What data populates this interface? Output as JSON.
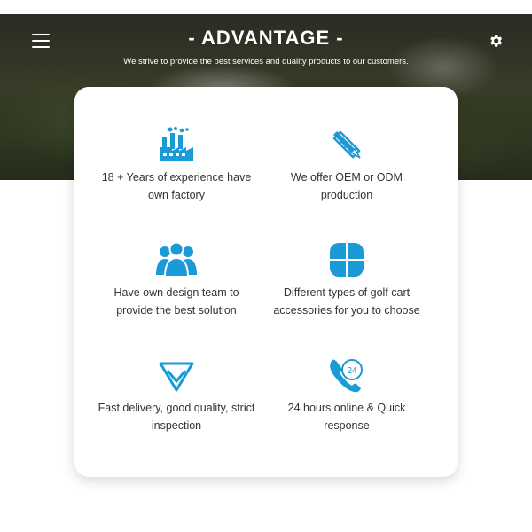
{
  "header": {
    "title": "- ADVANTAGE -",
    "subtitle": "We strive to provide the best services and quality products to our customers."
  },
  "icons": {
    "menu": "menu-icon",
    "settings": "gear-icon"
  },
  "colors": {
    "accent": "#1a9ad6",
    "text": "#333333",
    "card_bg": "#ffffff"
  },
  "features": [
    {
      "icon": "factory-icon",
      "text": "18 + Years of experience have own factory"
    },
    {
      "icon": "pencil-ruler-icon",
      "text": "We offer OEM or ODM production"
    },
    {
      "icon": "team-icon",
      "text": "Have own design team to provide the best solution"
    },
    {
      "icon": "clover-grid-icon",
      "text": "Different types of golf cart accessories for you to choose"
    },
    {
      "icon": "diamond-icon",
      "text": "Fast delivery, good quality, strict inspection"
    },
    {
      "icon": "phone-24-icon",
      "text": "24 hours online & Quick response"
    }
  ]
}
